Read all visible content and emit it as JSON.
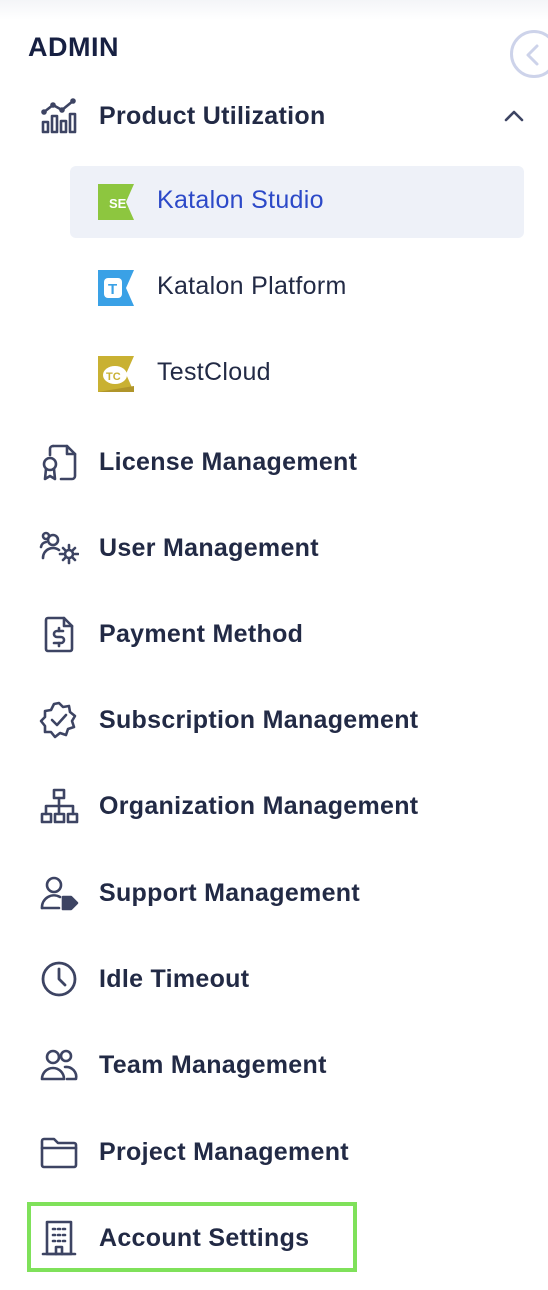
{
  "section_title": "ADMIN",
  "collapse_button": {
    "icon": "chevron-left-icon"
  },
  "product_utilization": {
    "label": "Product Utilization",
    "icon": "analytics-chart-icon",
    "expanded": true,
    "sub_items": [
      {
        "label": "Katalon Studio",
        "logo_text": "SE",
        "logo_color": "#8dc63f",
        "active": true
      },
      {
        "label": "Katalon Platform",
        "logo_text": "T",
        "logo_color": "#3aa1e6",
        "active": false
      },
      {
        "label": "TestCloud",
        "logo_text": "TC",
        "logo_color": "#c9b132",
        "active": false
      }
    ]
  },
  "menu": [
    {
      "label": "License Management",
      "icon": "license-certificate-icon"
    },
    {
      "label": "User Management",
      "icon": "users-gear-icon"
    },
    {
      "label": "Payment Method",
      "icon": "invoice-dollar-icon"
    },
    {
      "label": "Subscription Management",
      "icon": "badge-check-icon"
    },
    {
      "label": "Organization Management",
      "icon": "org-chart-icon"
    },
    {
      "label": "Support Management",
      "icon": "user-tag-icon"
    },
    {
      "label": "Idle Timeout",
      "icon": "clock-icon"
    },
    {
      "label": "Team Management",
      "icon": "team-users-icon"
    },
    {
      "label": "Project Management",
      "icon": "folder-icon"
    },
    {
      "label": "Account Settings",
      "icon": "building-icon"
    }
  ],
  "colors": {
    "text": "#222a45",
    "active_text": "#2c49c8",
    "active_bg": "#eef1f8",
    "highlight": "#7fe15a"
  }
}
